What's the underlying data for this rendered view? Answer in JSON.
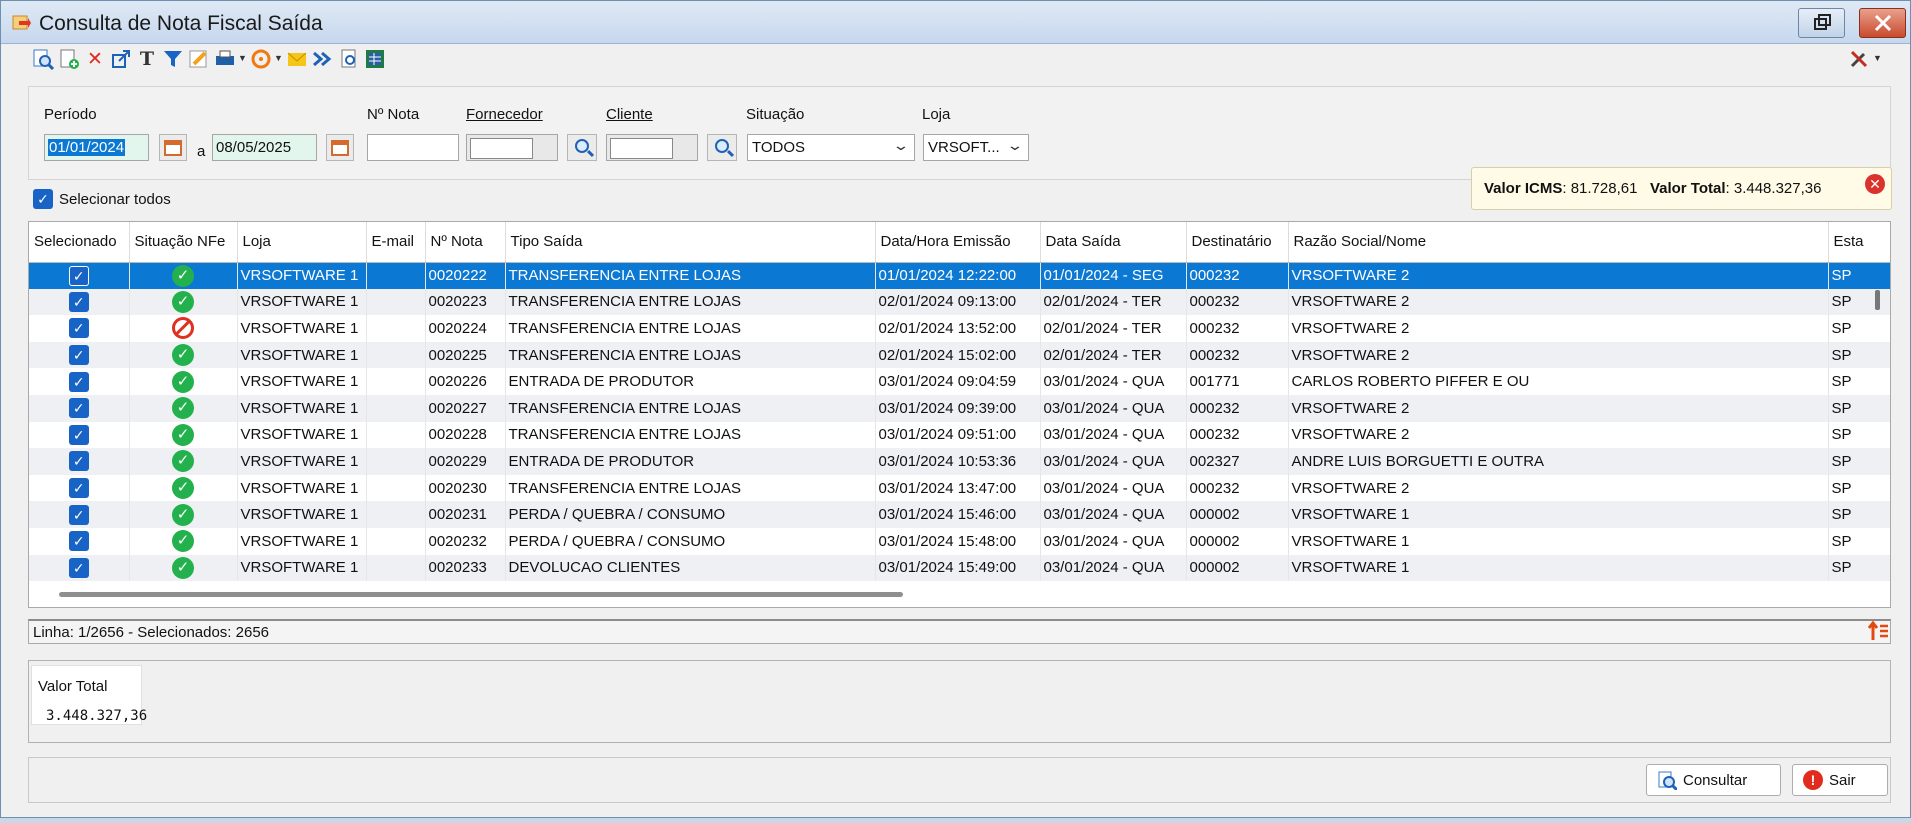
{
  "window": {
    "title": "Consulta de Nota Fiscal Saída"
  },
  "toolbar": {
    "icons": [
      "search-doc-icon",
      "new-doc-icon",
      "delete-icon",
      "export-icon",
      "text-format-icon",
      "filter-icon",
      "edit-icon",
      "print-icon",
      "refresh-icon",
      "email-icon",
      "forward-icon",
      "preview-icon",
      "spreadsheet-icon"
    ],
    "settings_icon": "tools-icon"
  },
  "filters": {
    "periodo_label": "Período",
    "date_from": "01/01/2024",
    "date_sep": "a",
    "date_to": "08/05/2025",
    "nota_label": "Nº Nota",
    "nota_value": "",
    "fornecedor_label": "Fornecedor",
    "cliente_label": "Cliente",
    "situacao_label": "Situação",
    "situacao_value": "TODOS",
    "loja_label": "Loja",
    "loja_value": "VRSOFT..."
  },
  "select_all_label": "Selecionar todos",
  "tooltip": {
    "icms_label": "Valor ICMS",
    "icms_value": ": 81.728,61",
    "total_label": "Valor Total",
    "total_value": ": 3.448.327,36"
  },
  "grid": {
    "columns": [
      "Selecionado",
      "Situação NFe",
      "Loja",
      "E-mail",
      "Nº Nota",
      "Tipo Saída",
      "Data/Hora Emissão",
      "Data Saída",
      "Destinatário",
      "Razão Social/Nome",
      "Esta"
    ],
    "rows": [
      {
        "status": "ok",
        "loja": "VRSOFTWARE 1",
        "email": "",
        "nota": "0020222",
        "tipo": "TRANSFERENCIA ENTRE LOJAS",
        "emissao": "01/01/2024 12:22:00",
        "saida": "01/01/2024 - SEG",
        "dest": "000232",
        "razao": "VRSOFTWARE 2",
        "uf": "SP"
      },
      {
        "status": "ok",
        "loja": "VRSOFTWARE 1",
        "email": "",
        "nota": "0020223",
        "tipo": "TRANSFERENCIA ENTRE LOJAS",
        "emissao": "02/01/2024 09:13:00",
        "saida": "02/01/2024 - TER",
        "dest": "000232",
        "razao": "VRSOFTWARE 2",
        "uf": "SP"
      },
      {
        "status": "cancel",
        "loja": "VRSOFTWARE 1",
        "email": "",
        "nota": "0020224",
        "tipo": "TRANSFERENCIA ENTRE LOJAS",
        "emissao": "02/01/2024 13:52:00",
        "saida": "02/01/2024 - TER",
        "dest": "000232",
        "razao": "VRSOFTWARE 2",
        "uf": "SP"
      },
      {
        "status": "ok",
        "loja": "VRSOFTWARE 1",
        "email": "",
        "nota": "0020225",
        "tipo": "TRANSFERENCIA ENTRE LOJAS",
        "emissao": "02/01/2024 15:02:00",
        "saida": "02/01/2024 - TER",
        "dest": "000232",
        "razao": "VRSOFTWARE 2",
        "uf": "SP"
      },
      {
        "status": "ok",
        "loja": "VRSOFTWARE 1",
        "email": "",
        "nota": "0020226",
        "tipo": "ENTRADA DE PRODUTOR",
        "emissao": "03/01/2024 09:04:59",
        "saida": "03/01/2024 - QUA",
        "dest": "001771",
        "razao": "CARLOS ROBERTO PIFFER E OU",
        "uf": "SP"
      },
      {
        "status": "ok",
        "loja": "VRSOFTWARE 1",
        "email": "",
        "nota": "0020227",
        "tipo": "TRANSFERENCIA ENTRE LOJAS",
        "emissao": "03/01/2024 09:39:00",
        "saida": "03/01/2024 - QUA",
        "dest": "000232",
        "razao": "VRSOFTWARE 2",
        "uf": "SP"
      },
      {
        "status": "ok",
        "loja": "VRSOFTWARE 1",
        "email": "",
        "nota": "0020228",
        "tipo": "TRANSFERENCIA ENTRE LOJAS",
        "emissao": "03/01/2024 09:51:00",
        "saida": "03/01/2024 - QUA",
        "dest": "000232",
        "razao": "VRSOFTWARE 2",
        "uf": "SP"
      },
      {
        "status": "ok",
        "loja": "VRSOFTWARE 1",
        "email": "",
        "nota": "0020229",
        "tipo": "ENTRADA DE PRODUTOR",
        "emissao": "03/01/2024 10:53:36",
        "saida": "03/01/2024 - QUA",
        "dest": "002327",
        "razao": "ANDRE LUIS BORGUETTI E OUTRA",
        "uf": "SP"
      },
      {
        "status": "ok",
        "loja": "VRSOFTWARE 1",
        "email": "",
        "nota": "0020230",
        "tipo": "TRANSFERENCIA ENTRE LOJAS",
        "emissao": "03/01/2024 13:47:00",
        "saida": "03/01/2024 - QUA",
        "dest": "000232",
        "razao": "VRSOFTWARE 2",
        "uf": "SP"
      },
      {
        "status": "ok",
        "loja": "VRSOFTWARE 1",
        "email": "",
        "nota": "0020231",
        "tipo": "PERDA / QUEBRA / CONSUMO",
        "emissao": "03/01/2024 15:46:00",
        "saida": "03/01/2024 - QUA",
        "dest": "000002",
        "razao": "VRSOFTWARE 1",
        "uf": "SP"
      },
      {
        "status": "ok",
        "loja": "VRSOFTWARE 1",
        "email": "",
        "nota": "0020232",
        "tipo": "PERDA / QUEBRA / CONSUMO",
        "emissao": "03/01/2024 15:48:00",
        "saida": "03/01/2024 - QUA",
        "dest": "000002",
        "razao": "VRSOFTWARE 1",
        "uf": "SP"
      },
      {
        "status": "ok",
        "loja": "VRSOFTWARE 1",
        "email": "",
        "nota": "0020233",
        "tipo": "DEVOLUCAO CLIENTES",
        "emissao": "03/01/2024 15:49:00",
        "saida": "03/01/2024 - QUA",
        "dest": "000002",
        "razao": "VRSOFTWARE 1",
        "uf": "SP"
      }
    ]
  },
  "status_bar": {
    "text": "Linha: 1/2656 - Selecionados: 2656"
  },
  "totals": {
    "label": "Valor Total",
    "value": "3.448.327,36"
  },
  "footer": {
    "consultar_label": "Consultar",
    "sair_label": "Sair"
  }
}
